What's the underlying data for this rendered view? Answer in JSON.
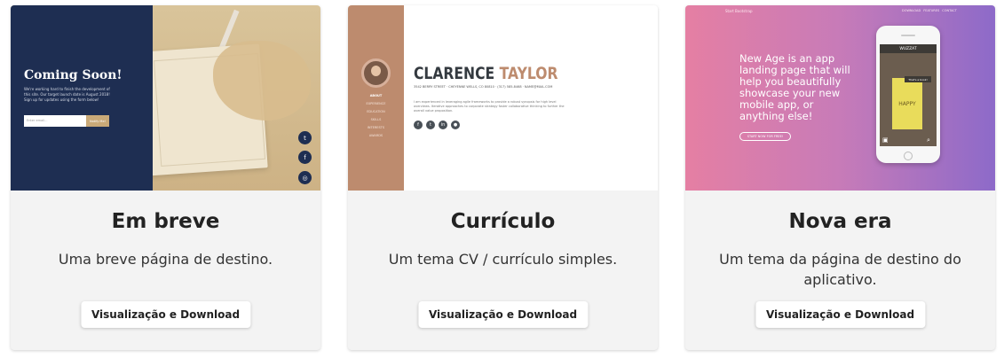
{
  "cards": [
    {
      "title": "Em breve",
      "description": "Uma breve página de destino.",
      "button": "Visualização e Download",
      "preview": {
        "heading": "Coming Soon!",
        "text": "We're working hard to finish the development of this site. Our target launch date is August 2018! Sign up for updates using the form below!",
        "email_placeholder": "Enter email...",
        "notify_button": "Notify Me!",
        "social_icons": [
          "twitter-icon",
          "facebook-icon",
          "instagram-icon"
        ]
      }
    },
    {
      "title": "Currículo",
      "description": "Um tema CV / currículo simples.",
      "button": "Visualização e Download",
      "preview": {
        "first_name": "CLARENCE",
        "last_name": "TAYLOR",
        "address": "3542 BERRY STREET · CHEYENNE WELLS, CO 80810 · (317) 585-8468 · NAME@MAIL.COM",
        "about": "I am experienced in leveraging agile frameworks to provide a robust synopsis for high level overviews. Iterative approaches to corporate strategy foster collaborative thinking to further the overall value proposition.",
        "nav": [
          "ABOUT",
          "EXPERIENCE",
          "EDUCATION",
          "SKILLS",
          "INTERESTS",
          "AWARDS"
        ],
        "social_icons": [
          "facebook-icon",
          "twitter-icon",
          "linkedin-icon",
          "github-icon"
        ]
      }
    },
    {
      "title": "Nova era",
      "description": "Um tema da página de destino do aplicativo.",
      "button": "Visualização e Download",
      "preview": {
        "brand": "Start Bootstrap",
        "nav": "DOWNLOAD FEATURES CONTACT",
        "hero": "New Age is an app landing page that will help you beautifully showcase your new mobile app, or anything else!",
        "start_button": "START NOW FOR FREE!",
        "app_name": "WUZZAT",
        "book_word": "HAPPY",
        "badge": "That's a book!"
      }
    }
  ]
}
